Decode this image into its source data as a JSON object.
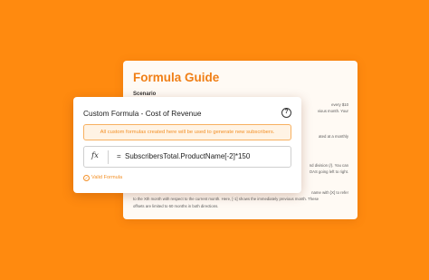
{
  "guide": {
    "title": "Formula Guide",
    "scenario_label": "Scenario",
    "lines": [
      "every $10",
      "vious month. Your",
      "ated at a monthly",
      "nd division (/). You can",
      "OAS going left to right.",
      "name with [X] to refer",
      "to the Xth month with respect to the current month. Here, [-1] shows the immediately previous month. These",
      "offsets are limited to 60 months in both directions."
    ]
  },
  "dialog": {
    "title": "Custom Formula - Cost of Revenue",
    "help_icon": "?",
    "notice": "All custom formulas created here will be used to generate new subscribers.",
    "fx_symbol": "fx",
    "equals": "=",
    "formula": "SubscribersTotal.ProductName[-2]*150",
    "valid_label": "Valid Formula",
    "valid_icon": "✓"
  }
}
